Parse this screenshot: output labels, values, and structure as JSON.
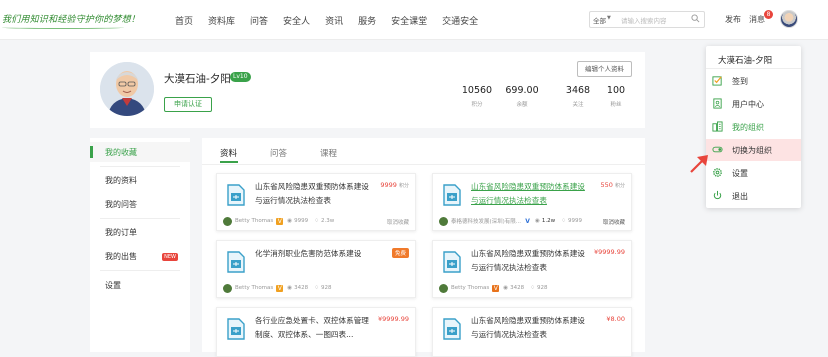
{
  "topbar": {
    "slogan": "我们用知识和经验守护你的梦想！",
    "nav": [
      "首页",
      "资料库",
      "问答",
      "安全人",
      "资讯",
      "服务",
      "安全课堂",
      "交通安全"
    ],
    "search": {
      "scope": "全部",
      "placeholder": "请输入搜索内容"
    },
    "publish": "发布",
    "messages": "消息",
    "message_count": "8"
  },
  "profile": {
    "name": "大漠石油-夕阳",
    "level": "Lv10",
    "apply_label": "申请认证",
    "edit_label": "编辑个人资料",
    "stats": [
      {
        "value": "10560",
        "label": "积分"
      },
      {
        "value": "699.00",
        "label": "余额"
      },
      {
        "value": "3468",
        "label": "关注"
      },
      {
        "value": "100",
        "label": "粉丝"
      }
    ]
  },
  "sidebar": {
    "items": [
      "我的收藏",
      "我的资料",
      "我的问答",
      "我的订单",
      "我的出售",
      "设置"
    ],
    "new_badge": "NEW"
  },
  "tabs": [
    "资料",
    "问答",
    "课程"
  ],
  "cards": [
    {
      "title": "山东省风险隐患双重预防体系建设与运行情况执法检查表",
      "price": "9999",
      "unit": "积分",
      "author": "Betty Thomas",
      "verify_color": "#f0a020",
      "views": "9999",
      "likes": "2.3w",
      "action": "取消收藏",
      "link": false
    },
    {
      "title": "山东省风险隐患双重预防体系建设与运行情况执法检查表",
      "price": "550",
      "unit": "积分",
      "author": "泰格德科技发展(深圳)有限...",
      "verify_color": "#2c6fd6",
      "views": "1.2w",
      "likes": "9999",
      "action": "取消收藏",
      "link": true
    },
    {
      "title": "化学消剂职业危害防范体系建设",
      "free": "免费",
      "author": "Betty Thomas",
      "verify_color": "#f0a020",
      "views": "3428",
      "likes": "928"
    },
    {
      "title": "山东省风险隐患双重预防体系建设与运行情况执法检查表",
      "price": "¥9999.99",
      "author": "Betty Thomas",
      "verify_color": "#e8731c",
      "views": "3428",
      "likes": "928",
      "link": false
    },
    {
      "title": "各行业应急处置卡、双控体系管理制度、双控体系、一图四表...",
      "price": "¥9999.99"
    },
    {
      "title": "山东省风险隐患双重预防体系建设与运行情况执法检查表",
      "price": "¥8.00"
    }
  ],
  "dropdown": {
    "name": "大漠石油-夕阳",
    "items": [
      {
        "label": "签到",
        "icon": "checkin-icon"
      },
      {
        "label": "用户中心",
        "icon": "user-center-icon"
      },
      {
        "label": "我的组织",
        "icon": "organization-icon"
      },
      {
        "label": "切换为组织",
        "icon": "switch-icon"
      },
      {
        "label": "设置",
        "icon": "gear-icon"
      },
      {
        "label": "退出",
        "icon": "power-icon"
      }
    ]
  },
  "colors": {
    "accent": "#3aa24a",
    "price": "#e8453c",
    "highlight": "#fde3e3"
  }
}
